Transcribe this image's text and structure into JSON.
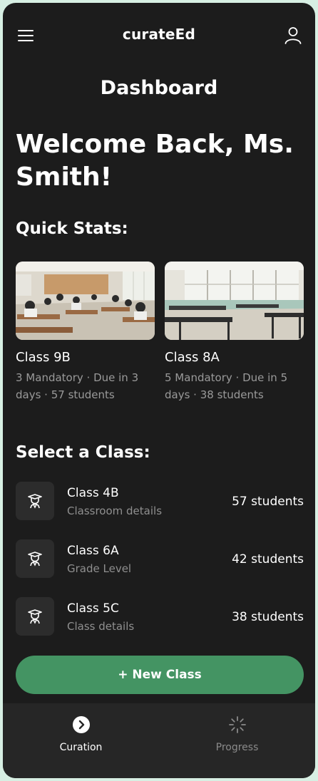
{
  "header": {
    "brand": "curateEd"
  },
  "screen_title": "Dashboard",
  "welcome": "Welcome Back, Ms. Smith!",
  "quick_stats": {
    "title": "Quick Stats:",
    "cards": [
      {
        "name": "Class 9B",
        "meta": "3 Mandatory · Due in 3 days · 57 students"
      },
      {
        "name": "Class 8A",
        "meta": "5 Mandatory · Due in 5 days · 38 students"
      }
    ]
  },
  "select_class": {
    "title": "Select a Class:",
    "items": [
      {
        "name": "Class 4B",
        "sub": "Classroom details",
        "count": "57 students"
      },
      {
        "name": "Class 6A",
        "sub": "Grade Level",
        "count": "42 students"
      },
      {
        "name": "Class 5C",
        "sub": "Class details",
        "count": "38 students"
      }
    ]
  },
  "new_class_label": "+ New Class",
  "nav": {
    "items": [
      {
        "label": "Curation",
        "icon": "chevron-circle-icon"
      },
      {
        "label": "Progress",
        "icon": "loader-icon"
      }
    ]
  },
  "colors": {
    "background": "#1c1c1c",
    "accent": "#449463",
    "muted": "#9a9a9a"
  }
}
